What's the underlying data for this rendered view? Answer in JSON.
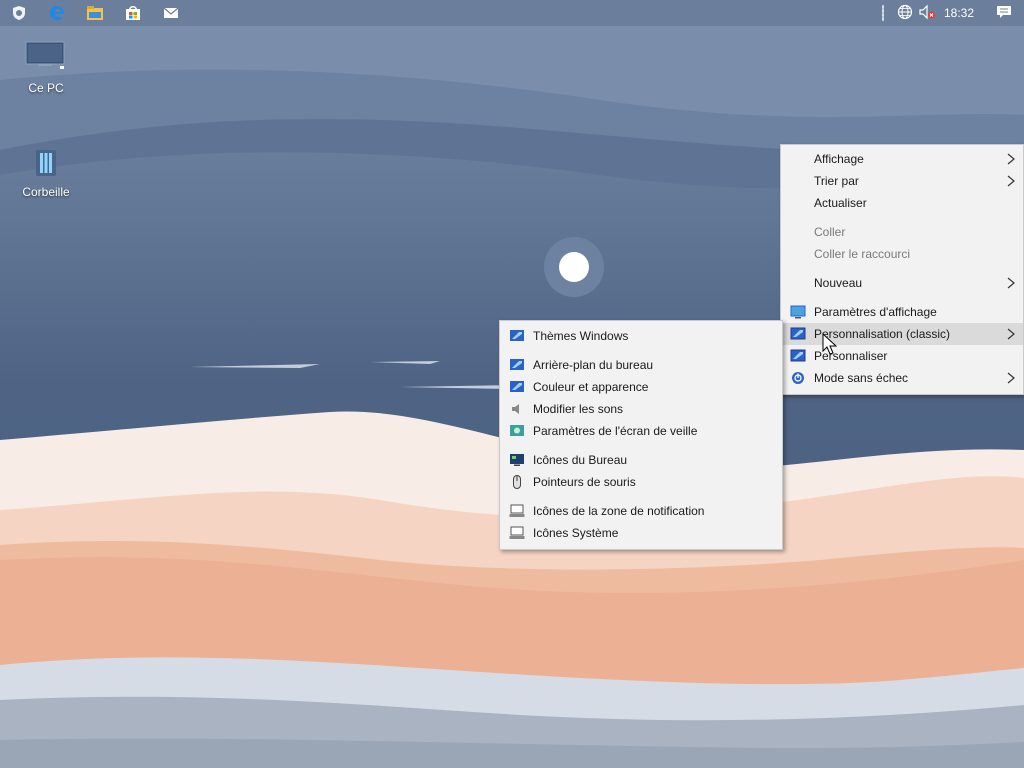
{
  "taskbar": {
    "buttons": [
      {
        "name": "shell-icon"
      },
      {
        "name": "edge-icon"
      },
      {
        "name": "file-explorer-icon"
      },
      {
        "name": "store-icon"
      },
      {
        "name": "mail-icon"
      }
    ],
    "tray": {
      "network_icon": "globe-icon",
      "volume_icon": "speaker-muted-icon",
      "clock": "18:32",
      "notification_icon": "action-center-icon"
    }
  },
  "desktop": {
    "icons": [
      {
        "label": "Ce PC",
        "icon": "computer-icon"
      },
      {
        "label": "Corbeille",
        "icon": "recycle-bin-icon"
      }
    ]
  },
  "context_menu": {
    "items": [
      {
        "label": "Affichage",
        "submenu": true
      },
      {
        "label": "Trier par",
        "submenu": true
      },
      {
        "label": "Actualiser"
      },
      {
        "label": "Coller",
        "disabled": true
      },
      {
        "label": "Coller le raccourci",
        "disabled": true
      },
      {
        "label": "Nouveau",
        "submenu": true
      },
      {
        "label": "Paramètres d'affichage",
        "icon": "display-settings-icon"
      },
      {
        "label": "Personnalisation (classic)",
        "icon": "personalization-icon",
        "submenu": true,
        "highlighted": true
      },
      {
        "label": "Personnaliser",
        "icon": "personalize-icon"
      },
      {
        "label": "Mode sans échec",
        "icon": "safe-mode-icon",
        "submenu": true
      }
    ]
  },
  "submenu": {
    "items": [
      {
        "label": "Thèmes Windows",
        "icon": "themes-icon"
      },
      {
        "label": "Arrière-plan du bureau",
        "icon": "desktop-background-icon"
      },
      {
        "label": "Couleur et apparence",
        "icon": "color-appearance-icon"
      },
      {
        "label": "Modifier les sons",
        "icon": "sounds-icon"
      },
      {
        "label": "Paramètres de l'écran de veille",
        "icon": "screensaver-icon"
      },
      {
        "label": "Icônes du Bureau",
        "icon": "desktop-icons-icon"
      },
      {
        "label": "Pointeurs de souris",
        "icon": "mouse-pointer-icon"
      },
      {
        "label": "Icônes de la zone de notification",
        "icon": "notification-area-icon"
      },
      {
        "label": "Icônes Système",
        "icon": "system-icons-icon"
      }
    ]
  },
  "colors": {
    "taskbar": "#6b7f9c",
    "sky_top": "#7589a6",
    "sky_mid": "#4f6484",
    "menu_bg": "#f2f2f2",
    "menu_highlight": "#dadada",
    "accent": "#2a62c9"
  }
}
